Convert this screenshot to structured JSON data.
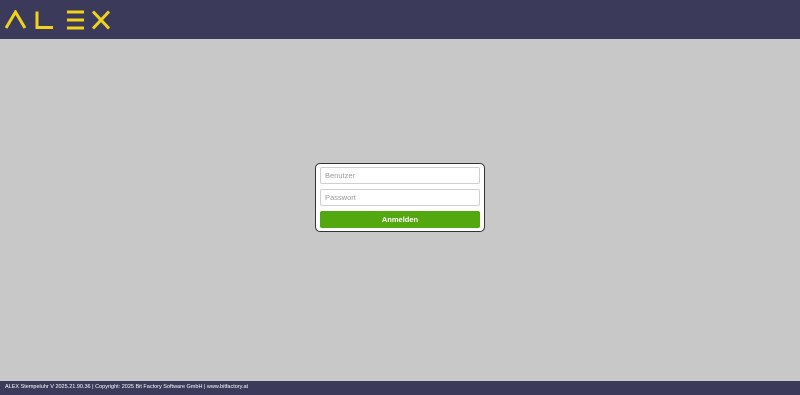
{
  "header": {
    "logo_text": "ALEX",
    "logo_color": "#f2d31b",
    "background": "#3b3a5a"
  },
  "login": {
    "username_placeholder": "Benutzer",
    "password_placeholder": "Passwort",
    "submit_label": "Anmelden",
    "submit_color": "#52a80e"
  },
  "footer": {
    "version_text": "ALEX Stempeluhr V 2025.21.90.36",
    "separator_1": " | ",
    "copyright_text": "Copyright: 2025 Bit Factory Software GmbH",
    "separator_2": " | ",
    "website_text": "www.bitfactory.at"
  }
}
